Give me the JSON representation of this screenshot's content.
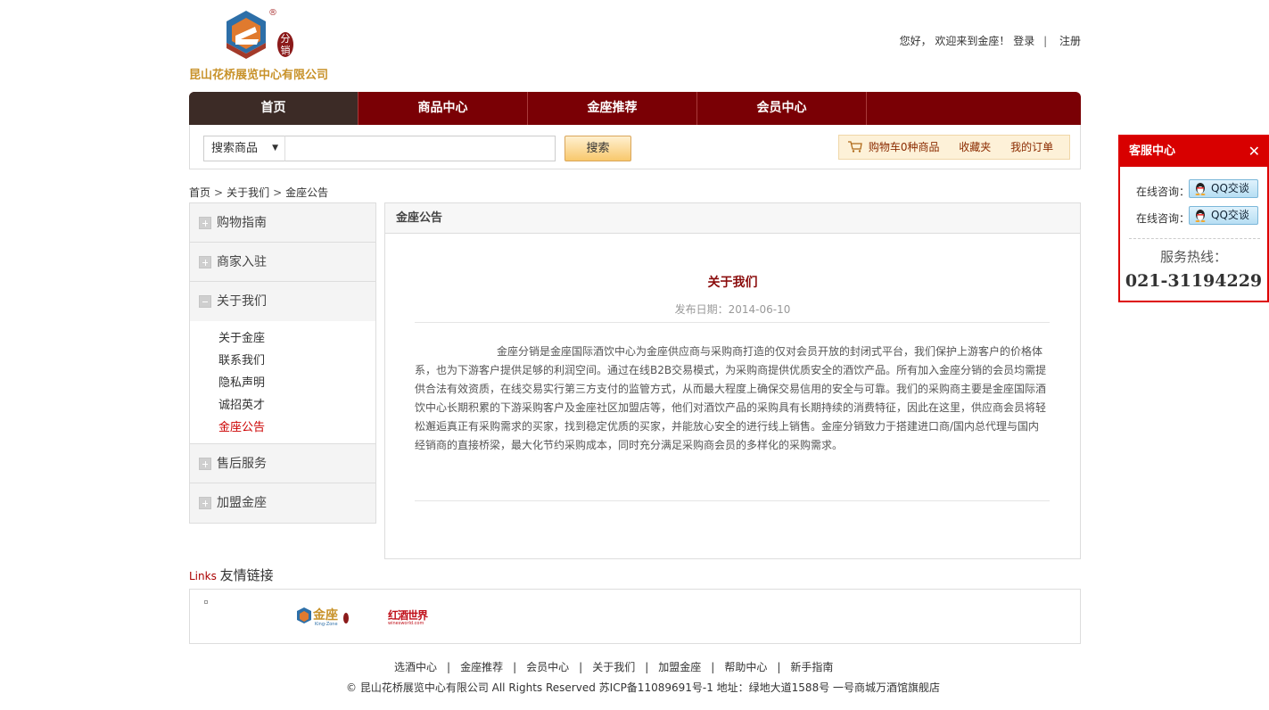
{
  "header": {
    "company": "昆山花桥展览中心有限公司",
    "logo_badge": "分销",
    "registered_mark": "®",
    "greeting": "您好， 欢迎来到金座！",
    "login": "登录",
    "separator": "|",
    "register": "注册"
  },
  "nav": {
    "items": [
      {
        "label": "首页",
        "active": true
      },
      {
        "label": "商品中心",
        "active": false
      },
      {
        "label": "金座推荐",
        "active": false
      },
      {
        "label": "会员中心",
        "active": false
      }
    ]
  },
  "search": {
    "select_value": "搜索商品",
    "select_arrow": "▼",
    "input_value": "",
    "button_label": "搜索",
    "cart_label": "购物车0种商品",
    "favorites_label": "收藏夹",
    "orders_label": "我的订单"
  },
  "breadcrumb": {
    "items": [
      "首页",
      "关于我们",
      "金座公告"
    ],
    "separator": ">"
  },
  "sidebar": {
    "categories": [
      {
        "label": "购物指南"
      },
      {
        "label": "商家入驻"
      },
      {
        "label": "关于我们"
      },
      {
        "label": "售后服务"
      },
      {
        "label": "加盟金座"
      }
    ],
    "sub_items": [
      {
        "label": "关于金座"
      },
      {
        "label": "联系我们"
      },
      {
        "label": "隐私声明"
      },
      {
        "label": "诚招英才"
      },
      {
        "label": "金座公告"
      }
    ]
  },
  "article": {
    "panel_title": "金座公告",
    "title": "关于我们",
    "date": "发布日期：2014-06-10",
    "body": "金座分销是金座国际酒饮中心为金座供应商与采购商打造的仅对会员开放的封闭式平台，我们保护上游客户的价格体系，也为下游客户提供足够的利润空间。通过在线B2B交易模式，为采购商提供优质安全的酒饮产品。所有加入金座分销的会员均需提供合法有效资质，在线交易实行第三方支付的监管方式，从而最大程度上确保交易信用的安全与可靠。我们的采购商主要是金座国际酒饮中心长期积累的下游采购客户及金座社区加盟店等，他们对酒饮产品的采购具有长期持续的消费特征，因此在这里，供应商会员将轻松邂逅真正有采购需求的买家，找到稳定优质的买家，并能放心安全的进行线上销售。金座分销致力于搭建进口商/国内总代理与国内经销商的直接桥梁，最大化节约采购成本，同时充分满足采购商会员的多样化的采购需求。"
  },
  "links": {
    "title_en": "Links",
    "title_cn": "友情链接",
    "logo1_text": "金座",
    "logo1_sub": "King-Zone",
    "logo2_text": "红酒世界",
    "logo2_sub": "winesworld.com"
  },
  "footer": {
    "nav": [
      "选酒中心",
      "金座推荐",
      "会员中心",
      "关于我们",
      "加盟金座",
      "帮助中心",
      "新手指南"
    ],
    "separator": "|",
    "copyright": "© 昆山花桥展览中心有限公司 All Rights Reserved 苏ICP备11089691号-1 地址：绿地大道1588号 一号商城万酒馆旗舰店"
  },
  "service": {
    "title": "客服中心",
    "close": "✕",
    "consult_label": "在线咨询：",
    "qq_label": "QQ交谈",
    "hotline_label": "服务热线：",
    "hotline": "021-31194229"
  },
  "colors": {
    "brand_red": "#7a0005",
    "nav_active": "#3c2b26",
    "service_red": "#d80000",
    "link_red": "#cc0000",
    "logo_gold": "#c8922a"
  }
}
